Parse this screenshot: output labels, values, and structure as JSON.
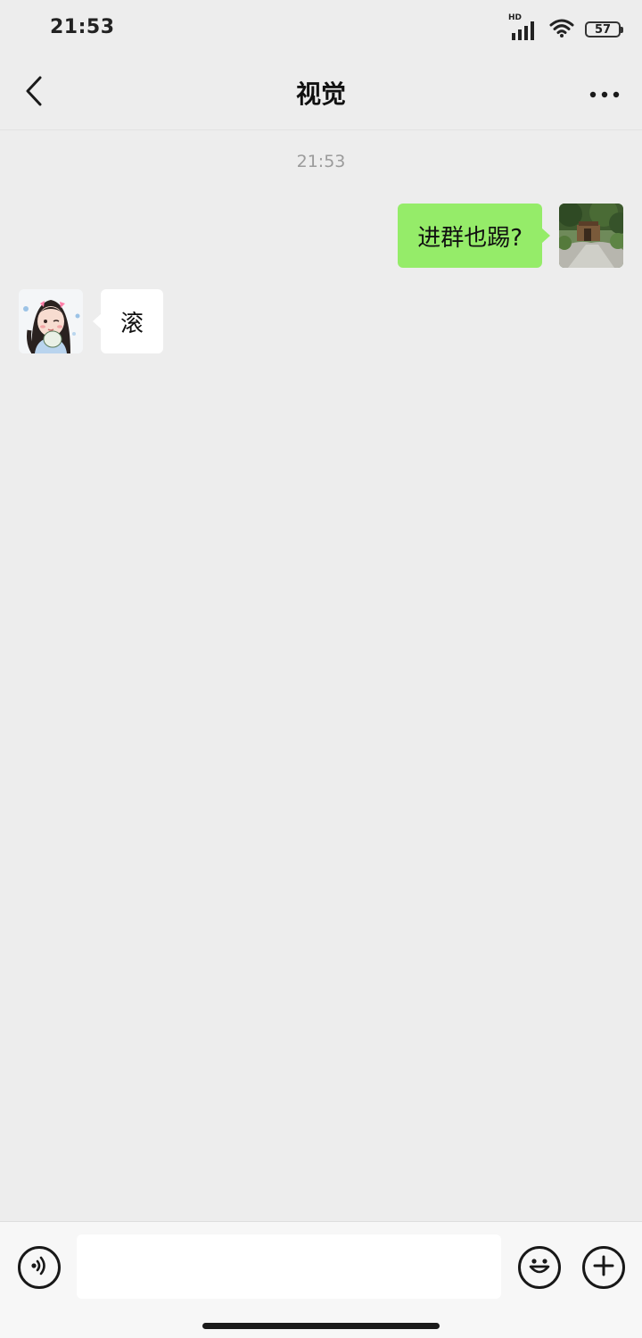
{
  "status_bar": {
    "time": "21:53",
    "network_label": "HD",
    "battery": "57"
  },
  "header": {
    "title": "视觉",
    "back_icon": "chevron-left-icon",
    "more_icon": "more-horizontal-icon"
  },
  "chat": {
    "timestamp": "21:53",
    "messages": [
      {
        "direction": "outgoing",
        "text": "进群也踢?",
        "avatar": "landscape-photo-avatar"
      },
      {
        "direction": "incoming",
        "text": "滚",
        "avatar": "cartoon-girl-avatar"
      }
    ]
  },
  "input_bar": {
    "voice_icon": "voice-icon",
    "input_value": "",
    "emoji_icon": "emoji-icon",
    "plus_icon": "plus-icon"
  },
  "colors": {
    "background": "#ededed",
    "outgoing_bubble": "#95ec69",
    "incoming_bubble": "#ffffff"
  }
}
